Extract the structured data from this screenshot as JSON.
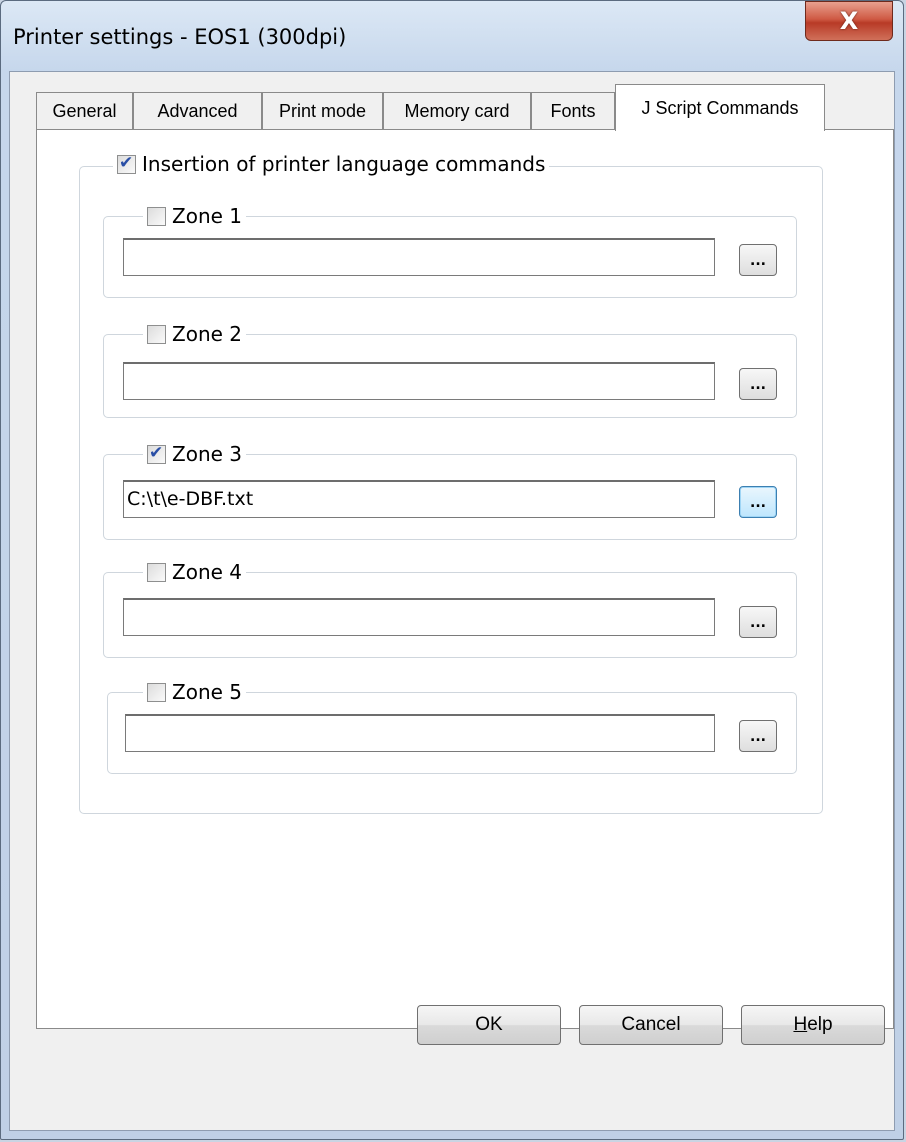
{
  "window": {
    "title": "Printer settings - EOS1 (300dpi)",
    "close_glyph": "X"
  },
  "tabs": [
    {
      "label": "General",
      "active": false
    },
    {
      "label": "Advanced",
      "active": false
    },
    {
      "label": "Print mode",
      "active": false
    },
    {
      "label": "Memory card",
      "active": false
    },
    {
      "label": "Fonts",
      "active": false
    },
    {
      "label": "J Script Commands",
      "active": true
    }
  ],
  "insertion": {
    "label": "Insertion of printer language commands",
    "checked": true
  },
  "zones": [
    {
      "label": "Zone 1",
      "checked": false,
      "value": "",
      "browse": "..."
    },
    {
      "label": "Zone 2",
      "checked": false,
      "value": "",
      "browse": "..."
    },
    {
      "label": "Zone 3",
      "checked": true,
      "value": "C:\\t\\e-DBF.txt",
      "browse": "..."
    },
    {
      "label": "Zone 4",
      "checked": false,
      "value": "",
      "browse": "..."
    },
    {
      "label": "Zone 5",
      "checked": false,
      "value": "",
      "browse": "..."
    }
  ],
  "buttons": {
    "ok": "OK",
    "cancel": "Cancel",
    "help_first": "H",
    "help_rest": "elp"
  }
}
